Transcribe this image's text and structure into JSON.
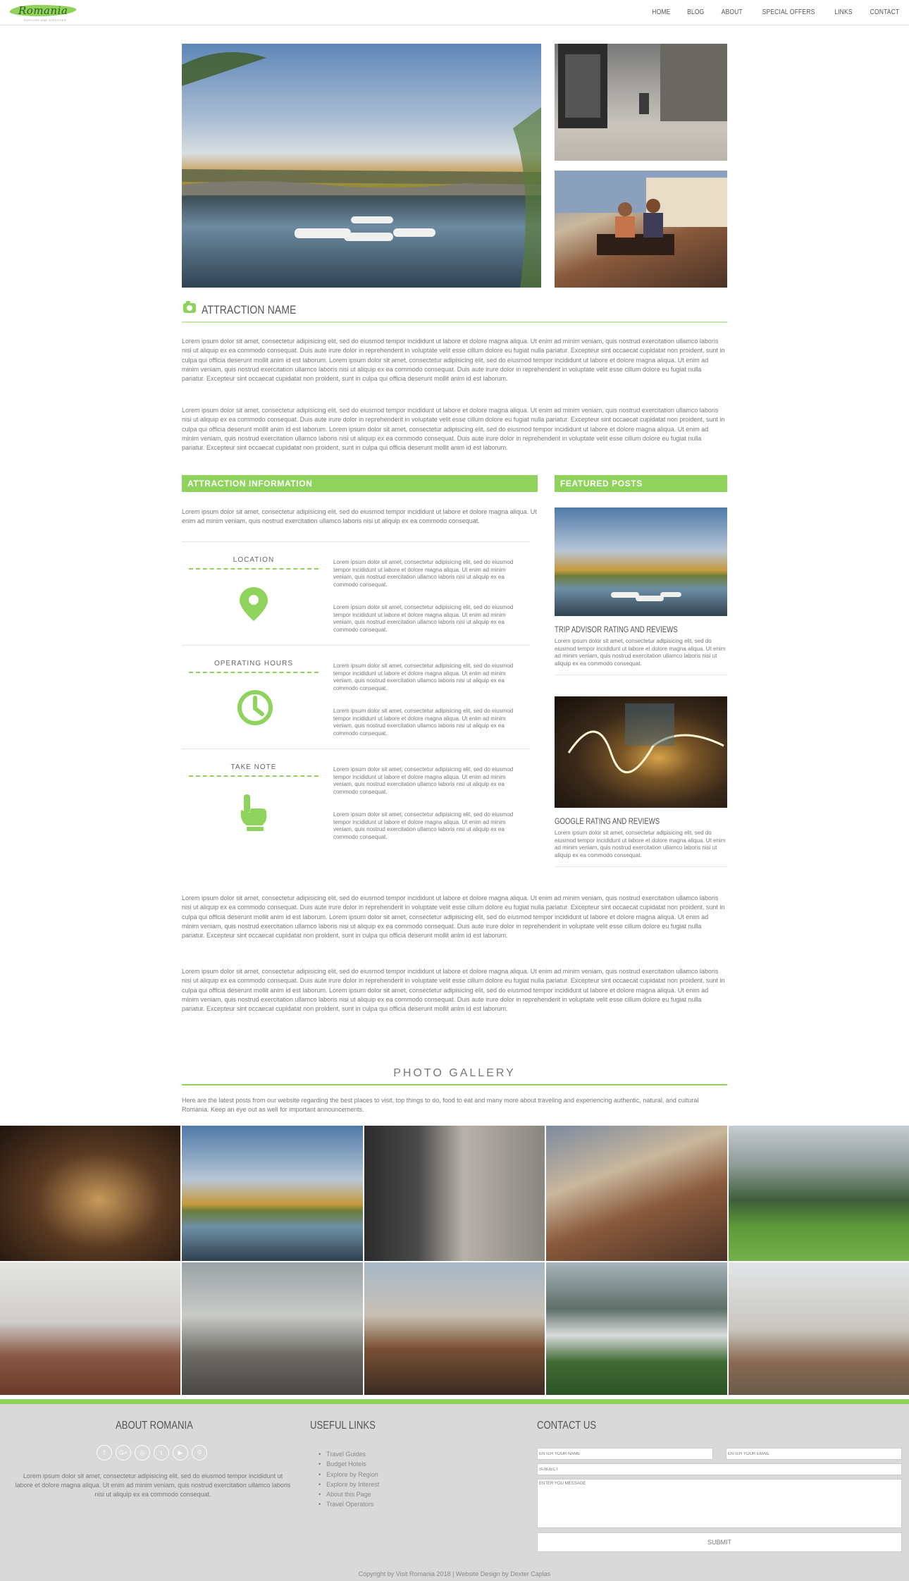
{
  "header": {
    "logo_text": "Romania",
    "logo_tagline": "EXPLORE AND DISCOVER",
    "nav": [
      "HOME",
      "BLOG",
      "ABOUT",
      "SPECIAL OFFERS",
      "LINKS",
      "CONTACT"
    ]
  },
  "attraction": {
    "title": "ATTRACTION NAME",
    "icon": "camera-icon",
    "para1": "Lorem ipsum dolor sit amet, consectetur adipisicing elit, sed do eiusmod tempor incididunt ut labore et dolore magna aliqua. Ut enim ad minim veniam, quis nostrud exercitation ullamco laboris nisi ut aliquip ex ea commodo consequat. Duis aute irure dolor in reprehenderit in voluptate velit esse cillum dolore eu fugiat nulla pariatur. Excepteur sint occaecat cupidatat non proident, sunt in culpa qui officia deserunt mollit anim id est laborum. Lorem ipsum dolor sit amet, consectetur adipisicing elit, sed do eiusmod tempor incididunt ut labore et dolore magna aliqua. Ut enim ad minim veniam, quis nostrud exercitation ullamco laboris nisi ut aliquip ex ea commodo consequat. Duis aute irure dolor in reprehenderit in voluptate velit esse cillum dolore eu fugiat nulla pariatur. Excepteur sint occaecat cupidatat non proident, sunt in culpa qui officia deserunt mollit anim id est laborum.",
    "para2": "Lorem ipsum dolor sit amet, consectetur adipisicing elit, sed do eiusmod tempor incididunt ut labore et dolore magna aliqua. Ut enim ad minim veniam, quis nostrud exercitation ullamco laboris nisi ut aliquip ex ea commodo consequat. Duis aute irure dolor in reprehenderit in voluptate velit esse cillum dolore eu fugiat nulla pariatur. Excepteur sint occaecat cupidatat non proident, sunt in culpa qui officia deserunt mollit anim id est laborum. Lorem ipsum dolor sit amet, consectetur adipisicing elit, sed do eiusmod tempor incididunt ut labore et dolore magna aliqua. Ut enim ad minim veniam, quis nostrud exercitation ullamco laboris nisi ut aliquip ex ea commodo consequat. Duis aute irure dolor in reprehenderit in voluptate velit esse cillum dolore eu fugiat nulla pariatur. Excepteur sint occaecat cupidatat non proident, sunt in culpa qui officia deserunt mollit anim id est laborum."
  },
  "info": {
    "heading": "ATTRACTION INFORMATION",
    "intro": "Lorem ipsum dolor sit amet, consectetur adipisicing elit, sed do eiusmod tempor incididunt ut labore et dolore magna aliqua. Ut enim ad minim veniam, quis nostrud exercitation ullamco laboris nisi ut aliquip ex ea commodo consequat.",
    "rows": [
      {
        "label": "LOCATION",
        "icon": "map-pin-icon"
      },
      {
        "label": "OPERATING HOURS",
        "icon": "clock-icon"
      },
      {
        "label": "TAKE NOTE",
        "icon": "pointing-hand-icon"
      }
    ],
    "row_text": "Lorem ipsum dolor sit amet, consectetur adipisicing elit, sed do eiusmod tempor incididunt ut labore et dolore magna aliqua. Ut enim ad minim veniam, quis nostrud exercitation ullamco laboris nisi ut aliquip ex ea commodo consequat."
  },
  "featured": {
    "heading": "FEATURED POSTS",
    "posts": [
      {
        "title": "TRIP ADVISOR RATING AND REVIEWS",
        "text": "Lorem ipsum dolor sit amet, consectetur adipisicing elit, sed do eiusmod tempor incididunt ut labore et dolore magna aliqua. Ut enim ad minim veniam, quis nostrud exercitation ullamco laboris nisi ut aliquip ex ea commodo consequat."
      },
      {
        "title": "GOOGLE RATING AND REVIEWS",
        "text": "Lorem ipsum dolor sit amet, consectetur adipisicing elit, sed do eiusmod tempor incididunt ut labore et dolore magna aliqua. Ut enim ad minim veniam, quis nostrud exercitation ullamco laboris nisi ut aliquip ex ea commodo consequat."
      }
    ]
  },
  "body2": {
    "para1": "Lorem ipsum dolor sit amet, consectetur adipisicing elit, sed do eiusmod tempor incididunt ut labore et dolore magna aliqua. Ut enim ad minim veniam, quis nostrud exercitation ullamco laboris nisi ut aliquip ex ea commodo consequat. Duis aute irure dolor in reprehenderit in voluptate velit esse cillum dolore eu fugiat nulla pariatur. Excepteur sint occaecat cupidatat non proident, sunt in culpa qui officia deserunt mollit anim id est laborum. Lorem ipsum dolor sit amet, consectetur adipisicing elit, sed do eiusmod tempor incididunt ut labore et dolore magna aliqua. Ut enim ad minim veniam, quis nostrud exercitation ullamco laboris nisi ut aliquip ex ea commodo consequat. Duis aute irure dolor in reprehenderit in voluptate velit esse cillum dolore eu fugiat nulla pariatur. Excepteur sint occaecat cupidatat non proident, sunt in culpa qui officia deserunt mollit anim id est laborum.",
    "para2": "Lorem ipsum dolor sit amet, consectetur adipisicing elit, sed do eiusmod tempor incididunt ut labore et dolore magna aliqua. Ut enim ad minim veniam, quis nostrud exercitation ullamco laboris nisi ut aliquip ex ea commodo consequat. Duis aute irure dolor in reprehenderit in voluptate velit esse cillum dolore eu fugiat nulla pariatur. Excepteur sint occaecat cupidatat non proident, sunt in culpa qui officia deserunt mollit anim id est laborum. Lorem ipsum dolor sit amet, consectetur adipisicing elit, sed do eiusmod tempor incididunt ut labore et dolore magna aliqua. Ut enim ad minim veniam, quis nostrud exercitation ullamco laboris nisi ut aliquip ex ea commodo consequat. Duis aute irure dolor in reprehenderit in voluptate velit esse cillum dolore eu fugiat nulla pariatur. Excepteur sint occaecat cupidatat non proident, sunt in culpa qui officia deserunt mollit anim id est laborum."
  },
  "gallery": {
    "title": "PHOTO GALLERY",
    "intro": "Here are the latest posts from our website regarding the best places to visit, top things to do, food to eat and many more about traveling and experiencing authentic, natural, and cultural Romania. Keep an eye out as well for important announcements."
  },
  "footer": {
    "about_heading": "ABOUT ROMANIA",
    "socials": [
      "f",
      "G+",
      "◎",
      "t",
      "▶",
      "⚲"
    ],
    "about_text": "Lorem ipsum dolor sit amet, consectetur adipisicing elit, sed do eiusmod tempor incididunt ut labore et dolore magna aliqua. Ut enim ad minim veniam, quis nostrud exercitation ullamco laboris nisi ut aliquip ex ea commodo consequat.",
    "links_heading": "USEFUL LINKS",
    "links": [
      "Travel Guides",
      "Budget Hotels",
      "Explore by Region",
      "Explore by Interest",
      "About this Page",
      "Travel Operators"
    ],
    "contact_heading": "CONTACT US",
    "name_placeholder": "ENTER YOUR NAME",
    "email_placeholder": "ENTER YOUR EMAIL",
    "subject_placeholder": "SUBJECT",
    "message_placeholder": "ENTER YOU MESSAGE",
    "submit": "SUBMIT",
    "copyright": "Copyright by Visit Romania 2018 | Website Design by Dexter Caplas"
  },
  "colors": {
    "accent": "#8fd35c",
    "footer_bg": "#d9d9d9"
  }
}
